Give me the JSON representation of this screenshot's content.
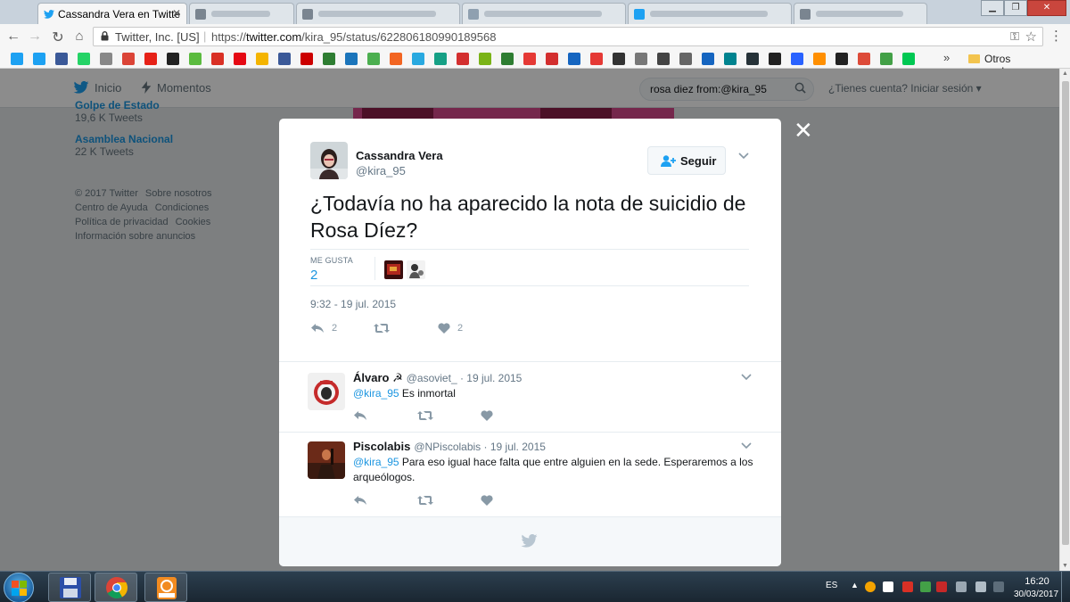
{
  "browser": {
    "tabs": [
      {
        "title": "Cassandra Vera en Twitte",
        "active": true
      },
      {
        "title": "",
        "active": false
      },
      {
        "title": "",
        "active": false
      },
      {
        "title": "",
        "active": false
      },
      {
        "title": "",
        "active": false
      },
      {
        "title": "",
        "active": false
      }
    ],
    "site_identity": "Twitter, Inc. [US]",
    "url_prefix": "https://",
    "url_host": "twitter.com",
    "url_path": "/kira_95/status/622806180990189568",
    "bookmarks_more": "»",
    "bookmarks_other": "Otros marcadores",
    "bookmark_colors": [
      "#1da1f2",
      "#1da1f2",
      "#3b5998",
      "#25d366",
      "#888888",
      "#db4437",
      "#e62117",
      "#222222",
      "#5bbb3f",
      "#d93025",
      "#e50914",
      "#f4b400",
      "#3b5998",
      "#cc0000",
      "#2e7d32",
      "#1b75bb",
      "#4caf50",
      "#f26522",
      "#29a9e0",
      "#16a085",
      "#d32f2f",
      "#7ab317",
      "#2e7d32",
      "#e53935",
      "#d32f2f",
      "#1565c0",
      "#e53935",
      "#333333",
      "#777777",
      "#444444",
      "#666666",
      "#1565c0",
      "#00838f",
      "#263238",
      "#222222",
      "#2962ff",
      "#ff8f00",
      "#222222",
      "#dd4b39",
      "#43a047",
      "#00c853"
    ]
  },
  "twitter": {
    "nav_home": "Inicio",
    "nav_moments": "Momentos",
    "search_value": "rosa diez from:@kira_95",
    "login": "¿Tienes cuenta? Iniciar sesión",
    "trends": [
      {
        "name": "Golpe de Estado",
        "count": "19,6 K Tweets"
      },
      {
        "name": "Asamblea Nacional",
        "count": "22 K Tweets"
      }
    ],
    "footer_links": [
      "© 2017 Twitter",
      "Sobre nosotros",
      "Centro de Ayuda",
      "Condiciones",
      "Política de privacidad",
      "Cookies",
      "Información sobre anuncios"
    ]
  },
  "modal": {
    "close": "✕",
    "author_name": "Cassandra Vera",
    "author_handle": "@kira_95",
    "follow_label": "Seguir",
    "tweet_text": "¿Todavía no ha aparecido la nota de suicidio de Rosa Díez?",
    "likes_label": "ME GUSTA",
    "likes_count": "2",
    "timestamp": "9:32 - 19 jul. 2015",
    "reply_count": "2",
    "like_count": "2",
    "replies": [
      {
        "name": "Álvaro ☭",
        "handle": "@asoviet_",
        "date": "· 19 jul. 2015",
        "mention": "@kira_95",
        "text": " Es inmortal"
      },
      {
        "name": "Piscolabis",
        "handle": "@NPiscolabis",
        "date": "· 19 jul. 2015",
        "mention": "@kira_95",
        "text": " Para eso igual hace falta que entre alguien en la sede. Esperaremos a los arqueólogos."
      }
    ]
  },
  "taskbar": {
    "lang": "ES",
    "time": "16:20",
    "date": "30/03/2017"
  },
  "colors": {
    "twitter_blue": "#1da1f2",
    "link_blue": "#1b95e0",
    "muted": "#657786",
    "like_gray": "#8899a6"
  }
}
